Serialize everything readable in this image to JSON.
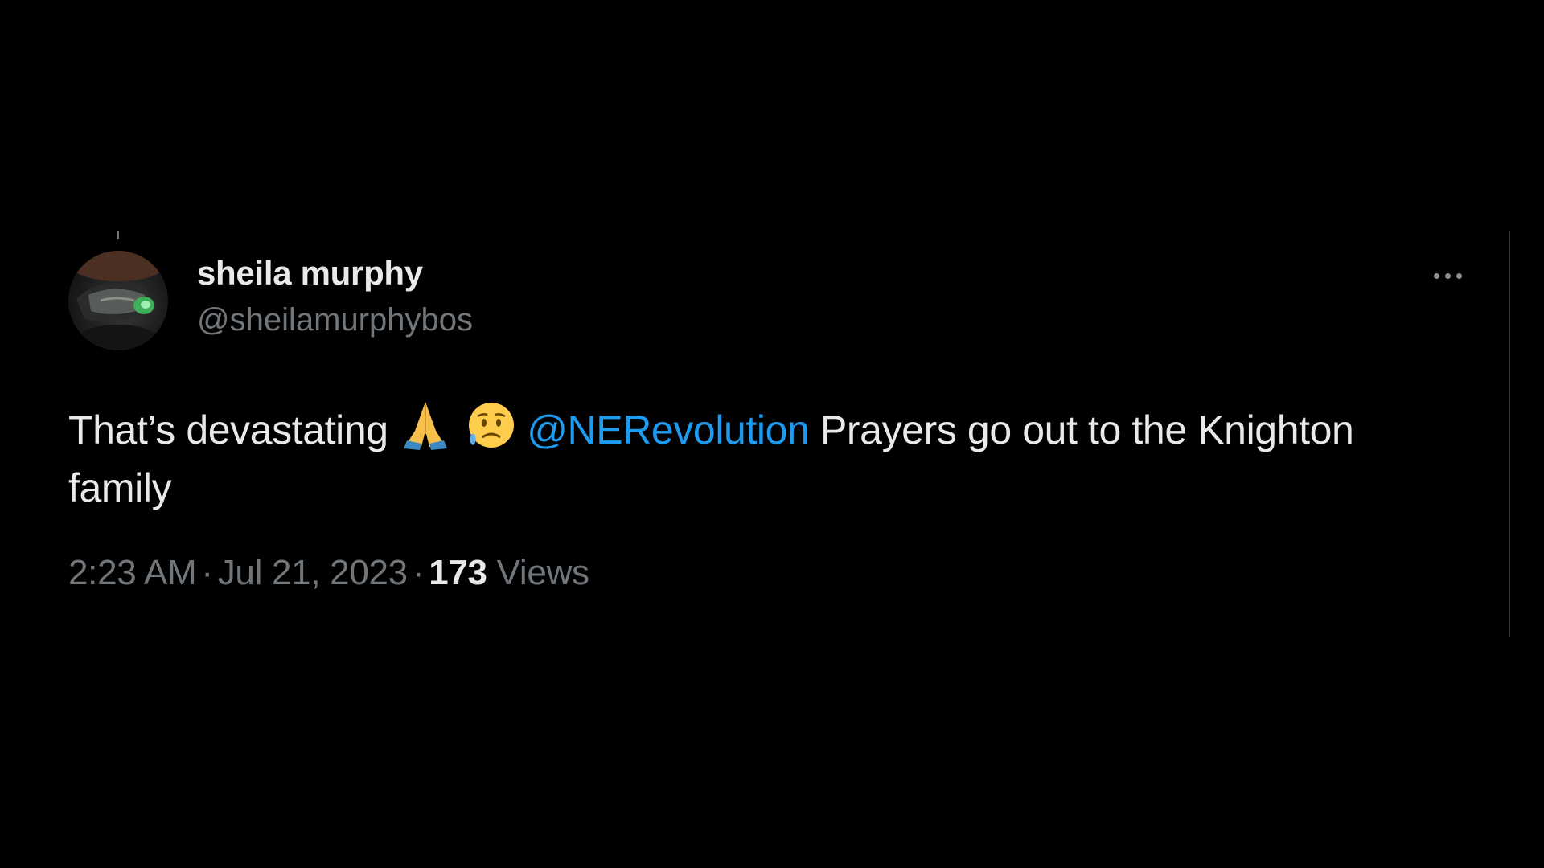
{
  "tweet": {
    "author": {
      "display_name": "sheila murphy",
      "handle": "@sheilamurphybos",
      "avatar_icon": "profile-photo-avatar"
    },
    "more_icon": "more-horizontal-icon",
    "text": {
      "before": "That’s devastating",
      "emojis": [
        "folded-hands-emoji",
        "sad-but-relieved-face-emoji"
      ],
      "mention": "@NERevolution",
      "after": "Prayers go out to the Knighton family"
    },
    "meta": {
      "time": "2:23 AM",
      "separator": "·",
      "date": "Jul 21, 2023",
      "views_count": "173",
      "views_label": "Views"
    }
  },
  "colors": {
    "background": "#000000",
    "primary_text": "#e7e9ea",
    "secondary_text": "#71767b",
    "link": "#1d9bf0",
    "divider": "#2f3336"
  }
}
